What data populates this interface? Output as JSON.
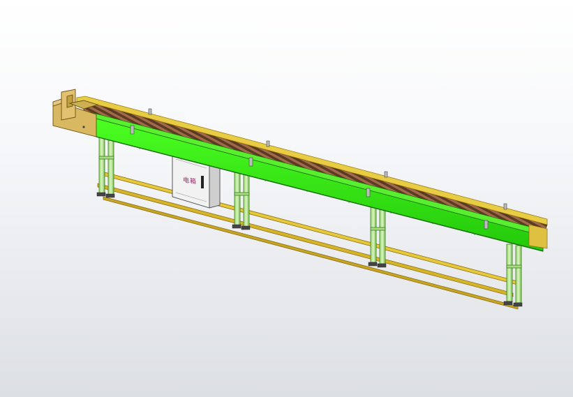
{
  "cabinet": {
    "label": "电箱"
  },
  "colors": {
    "frame_green": "#33ee11",
    "frame_dark": "#1f8a0a",
    "rail_yellow": "#e6c83a",
    "rail_dark": "#a48a1a",
    "end_block": "#d8b860",
    "rollers": "#8a5a3a",
    "legs": "#c8e8a8",
    "cabinet": "#eeeeee",
    "background": "#f4f5f7"
  },
  "objects": [
    "conveyor-frame",
    "roller-bed",
    "side-guide-rails",
    "end-stop-block",
    "support-legs",
    "base-stretchers",
    "leveling-feet",
    "electrical-cabinet"
  ]
}
